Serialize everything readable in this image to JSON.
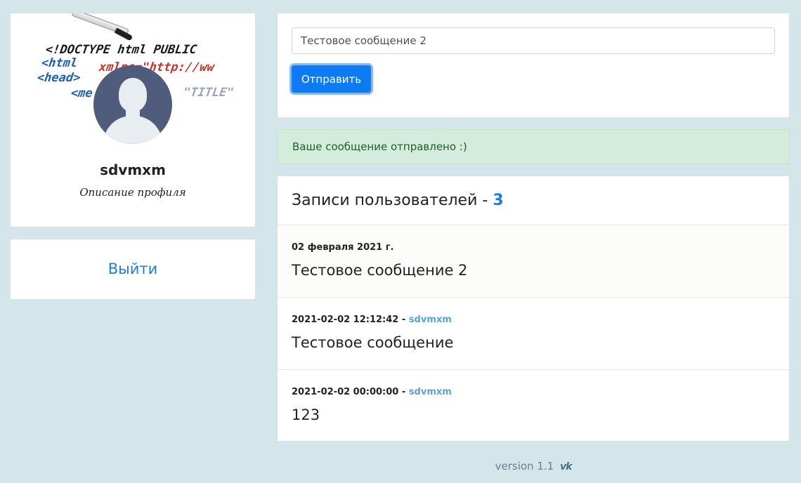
{
  "profile": {
    "banner_code_lines": [
      "<!DOCTYPE html PUBLIC",
      "<html",
      "xmlns=\"http://ww",
      "<head>",
      "<me",
      "\"TITLE\""
    ],
    "username": "sdvmxm",
    "description": "Описание профиля",
    "logout_label": "Выйти"
  },
  "form": {
    "input_value": "Тестовое сообщение 2",
    "send_label": "Отправить"
  },
  "alert": {
    "text": "Ваше сообщение отправлено :)"
  },
  "posts": {
    "title": "Записи пользователей - ",
    "count": "3",
    "items": [
      {
        "meta": "02 февраля 2021 г.",
        "author": "",
        "text": "Тестовое сообщение 2"
      },
      {
        "meta": "2021-02-02 12:12:42 - ",
        "author": "sdvmxm",
        "text": "Тестовое сообщение"
      },
      {
        "meta": "2021-02-02 00:00:00 - ",
        "author": "sdvmxm",
        "text": "123"
      }
    ]
  },
  "footer": {
    "version": "version 1.1",
    "vk_icon": "vk-icon"
  },
  "colors": {
    "background": "#d5e6eb",
    "primary": "#0d7cf2",
    "link": "#1a7fd4",
    "alert_bg": "#d4ecdc",
    "alert_text": "#1f5c33",
    "avatar": "#4f5c7c"
  }
}
